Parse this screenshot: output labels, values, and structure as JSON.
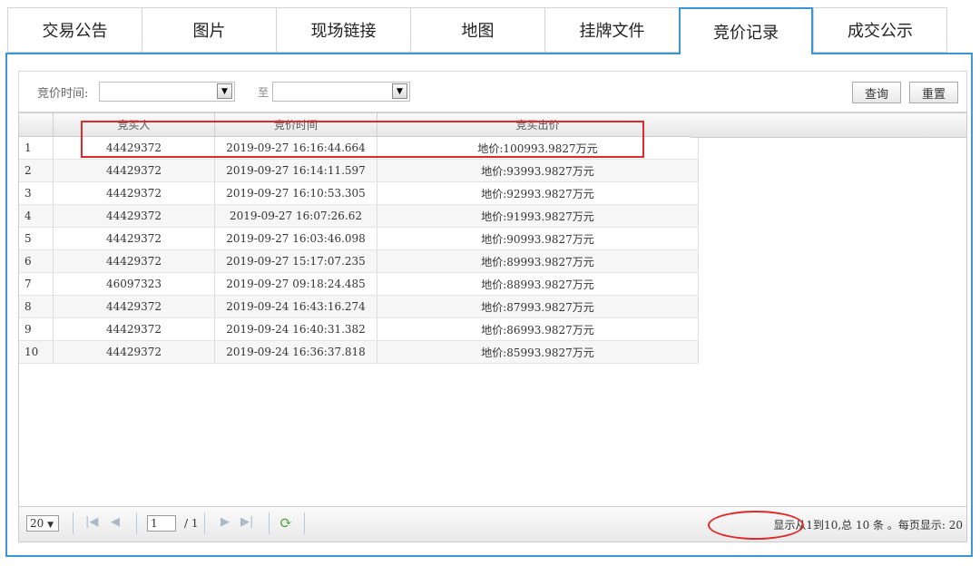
{
  "tabs": [
    "交易公告",
    "图片",
    "现场链接",
    "地图",
    "挂牌文件",
    "竞价记录",
    "成交公示"
  ],
  "active_tab": 5,
  "search": {
    "label": "竞价时间:",
    "to": "至",
    "query_button": "查询",
    "reset_button": "重置",
    "dropdown_icon": "▼"
  },
  "grid": {
    "headers": [
      "",
      "竞买人",
      "竞价时间",
      "竞买出价"
    ],
    "rows": [
      [
        "1",
        "44429372",
        "2019-09-27 16:16:44.664",
        "地价:100993.9827万元"
      ],
      [
        "2",
        "44429372",
        "2019-09-27 16:14:11.597",
        "地价:93993.9827万元"
      ],
      [
        "3",
        "44429372",
        "2019-09-27 16:10:53.305",
        "地价:92993.9827万元"
      ],
      [
        "4",
        "44429372",
        "2019-09-27 16:07:26.62",
        "地价:91993.9827万元"
      ],
      [
        "5",
        "44429372",
        "2019-09-27 16:03:46.098",
        "地价:90993.9827万元"
      ],
      [
        "6",
        "44429372",
        "2019-09-27 15:17:07.235",
        "地价:89993.9827万元"
      ],
      [
        "7",
        "46097323",
        "2019-09-27 09:18:24.485",
        "地价:88993.9827万元"
      ],
      [
        "8",
        "44429372",
        "2019-09-24 16:43:16.274",
        "地价:87993.9827万元"
      ],
      [
        "9",
        "44429372",
        "2019-09-24 16:40:31.382",
        "地价:86993.9827万元"
      ],
      [
        "10",
        "44429372",
        "2019-09-24 16:36:37.818",
        "地价:85993.9827万元"
      ]
    ]
  },
  "pager": {
    "page_size": "20",
    "page_size_arrow": "▼",
    "current_page": "1",
    "total_pages": "/ 1",
    "info_prefix": "显示从1到10,",
    "info_suffix": "总 10 条 。每页显示: 20",
    "icons": {
      "first": "|◀",
      "prev": "◀",
      "next": "▶",
      "last": "▶|",
      "refresh": "⟳"
    }
  },
  "colors": {
    "accent": "#3b97d3",
    "highlight": "#e02a2a"
  }
}
